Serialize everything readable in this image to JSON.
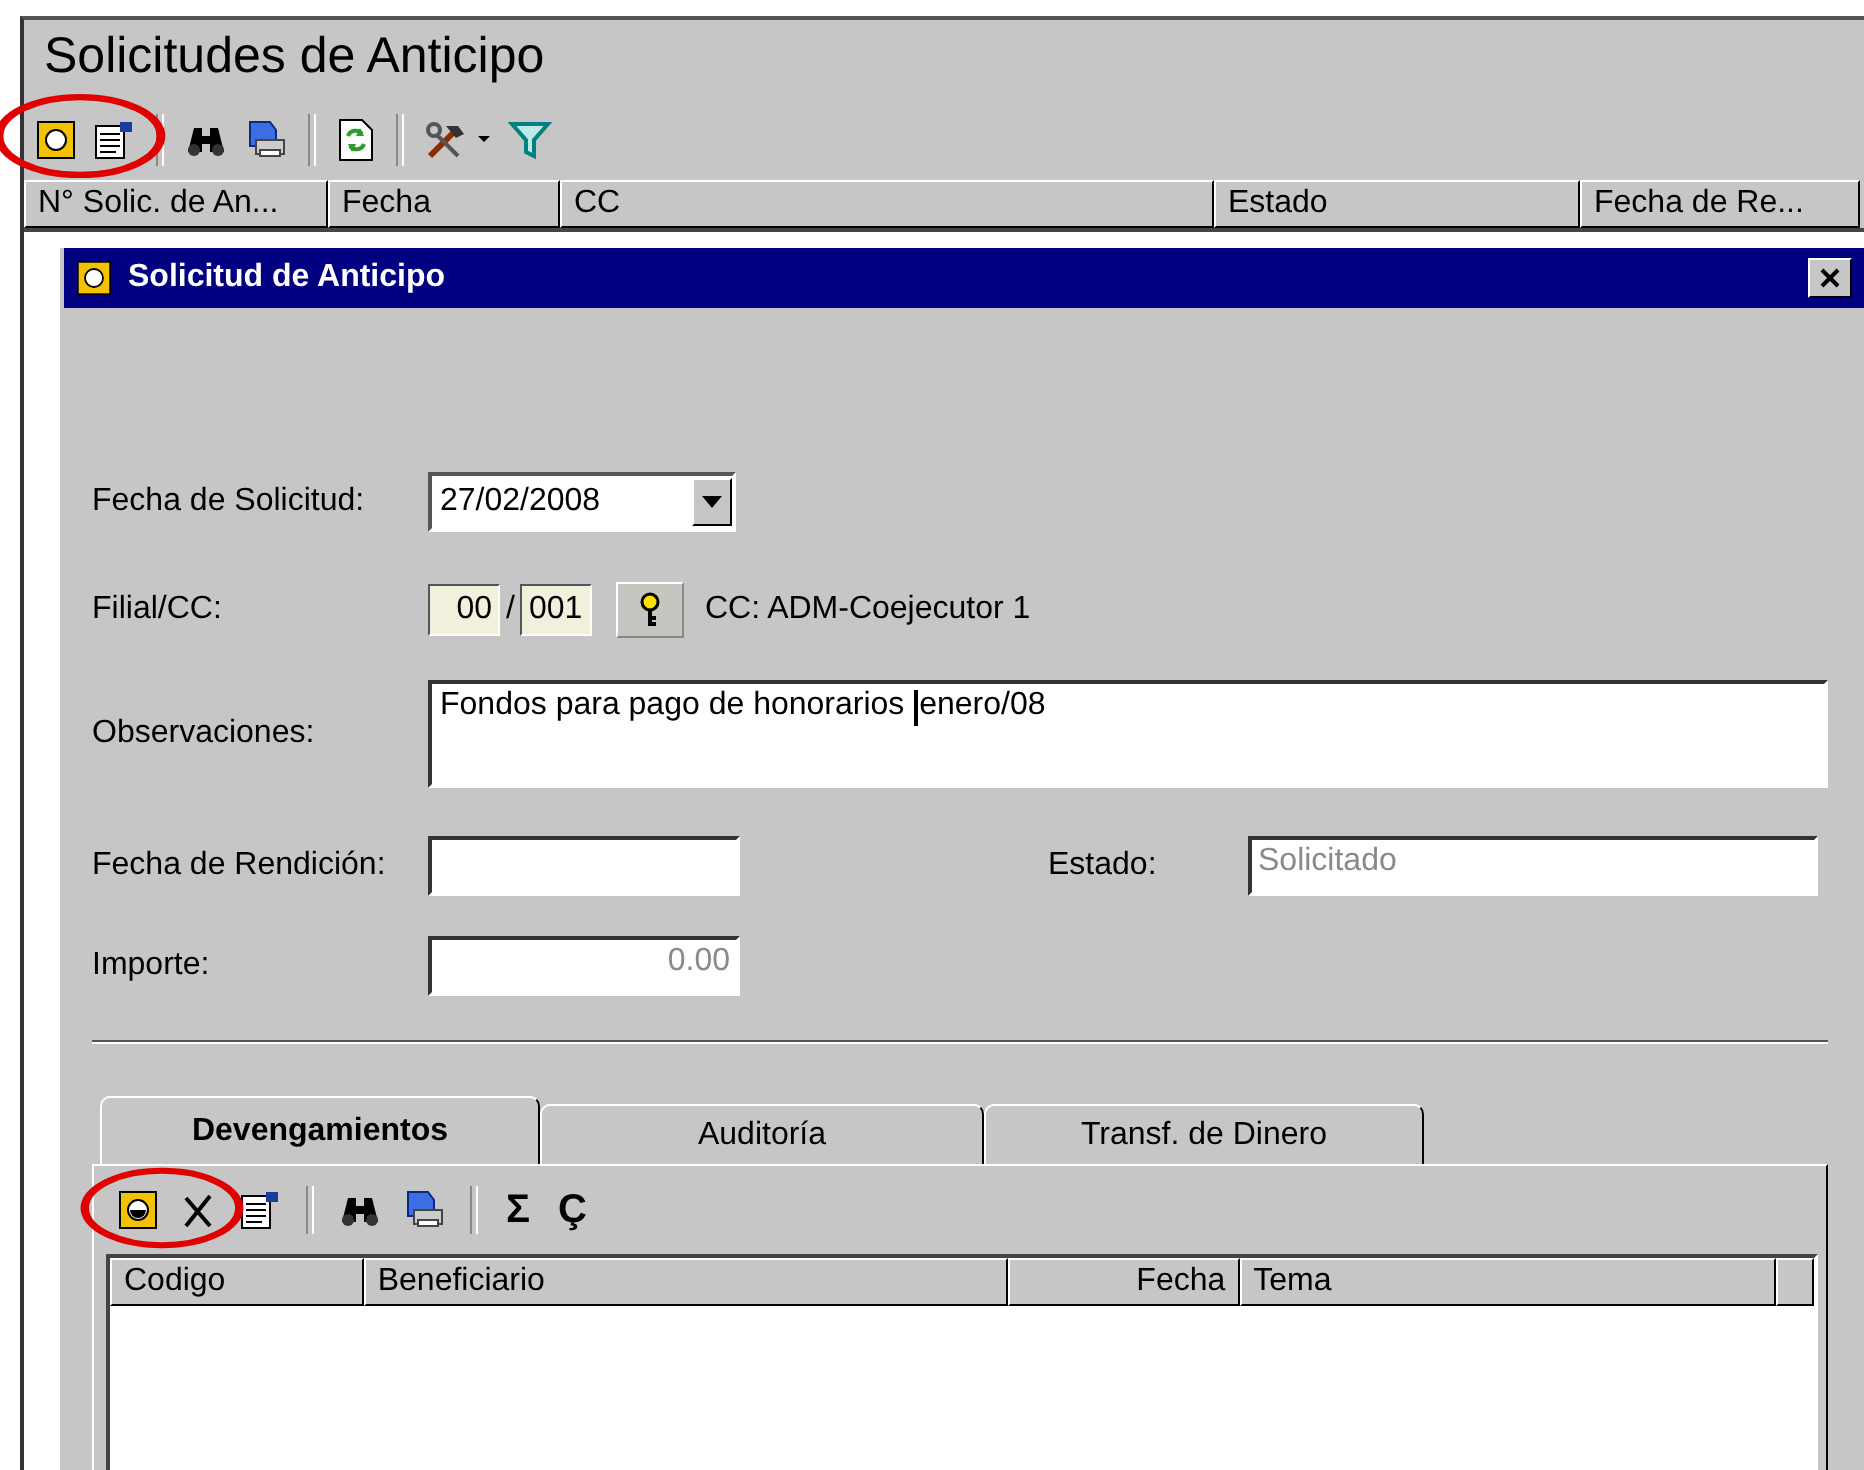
{
  "window": {
    "title": "Solicitudes de Anticipo"
  },
  "toolbar": {
    "highlighted": true,
    "items": [
      {
        "kind": "new"
      },
      {
        "kind": "properties"
      },
      {
        "kind": "separator"
      },
      {
        "kind": "find"
      },
      {
        "kind": "print"
      },
      {
        "kind": "separator"
      },
      {
        "kind": "refresh"
      },
      {
        "kind": "separator"
      },
      {
        "kind": "tools"
      },
      {
        "kind": "filter"
      }
    ]
  },
  "list_columns": [
    "N° Solic. de An...",
    "Fecha",
    "CC",
    "Estado",
    "Fecha de Re..."
  ],
  "dialog": {
    "title": "Solicitud de Anticipo",
    "fecha_solicitud": {
      "label": "Fecha de Solicitud:",
      "value": "27/02/2008"
    },
    "filial_cc": {
      "label": "Filial/CC:",
      "filial": "00",
      "separator": "/",
      "cc": "001",
      "description": "CC: ADM-Coejecutor 1"
    },
    "observaciones": {
      "label": "Observaciones:",
      "value": "Fondos para pago de honorarios ",
      "value_after_cursor": "enero/08"
    },
    "fecha_rendicion": {
      "label": "Fecha de Rendición:"
    },
    "estado": {
      "label": "Estado:",
      "value": "Solicitado",
      "disabled": true
    },
    "importe": {
      "label": "Importe:",
      "value": "0.00",
      "disabled": true
    },
    "tabs": [
      {
        "label": "Devengamientos",
        "selected": true
      },
      {
        "label": "Auditoría",
        "selected": false
      },
      {
        "label": "Transf. de Dinero",
        "selected": false
      }
    ],
    "tab_toolbar": {
      "highlighted": true,
      "items": [
        {
          "kind": "new"
        },
        {
          "kind": "delete"
        },
        {
          "kind": "properties"
        },
        {
          "kind": "separator"
        },
        {
          "kind": "find"
        },
        {
          "kind": "print"
        },
        {
          "kind": "separator"
        },
        {
          "kind": "text",
          "label": "Σ"
        },
        {
          "kind": "text",
          "label": "Ç"
        }
      ]
    },
    "grid_columns": [
      "Codigo",
      "Beneficiario",
      "Fecha",
      "Tema"
    ]
  }
}
